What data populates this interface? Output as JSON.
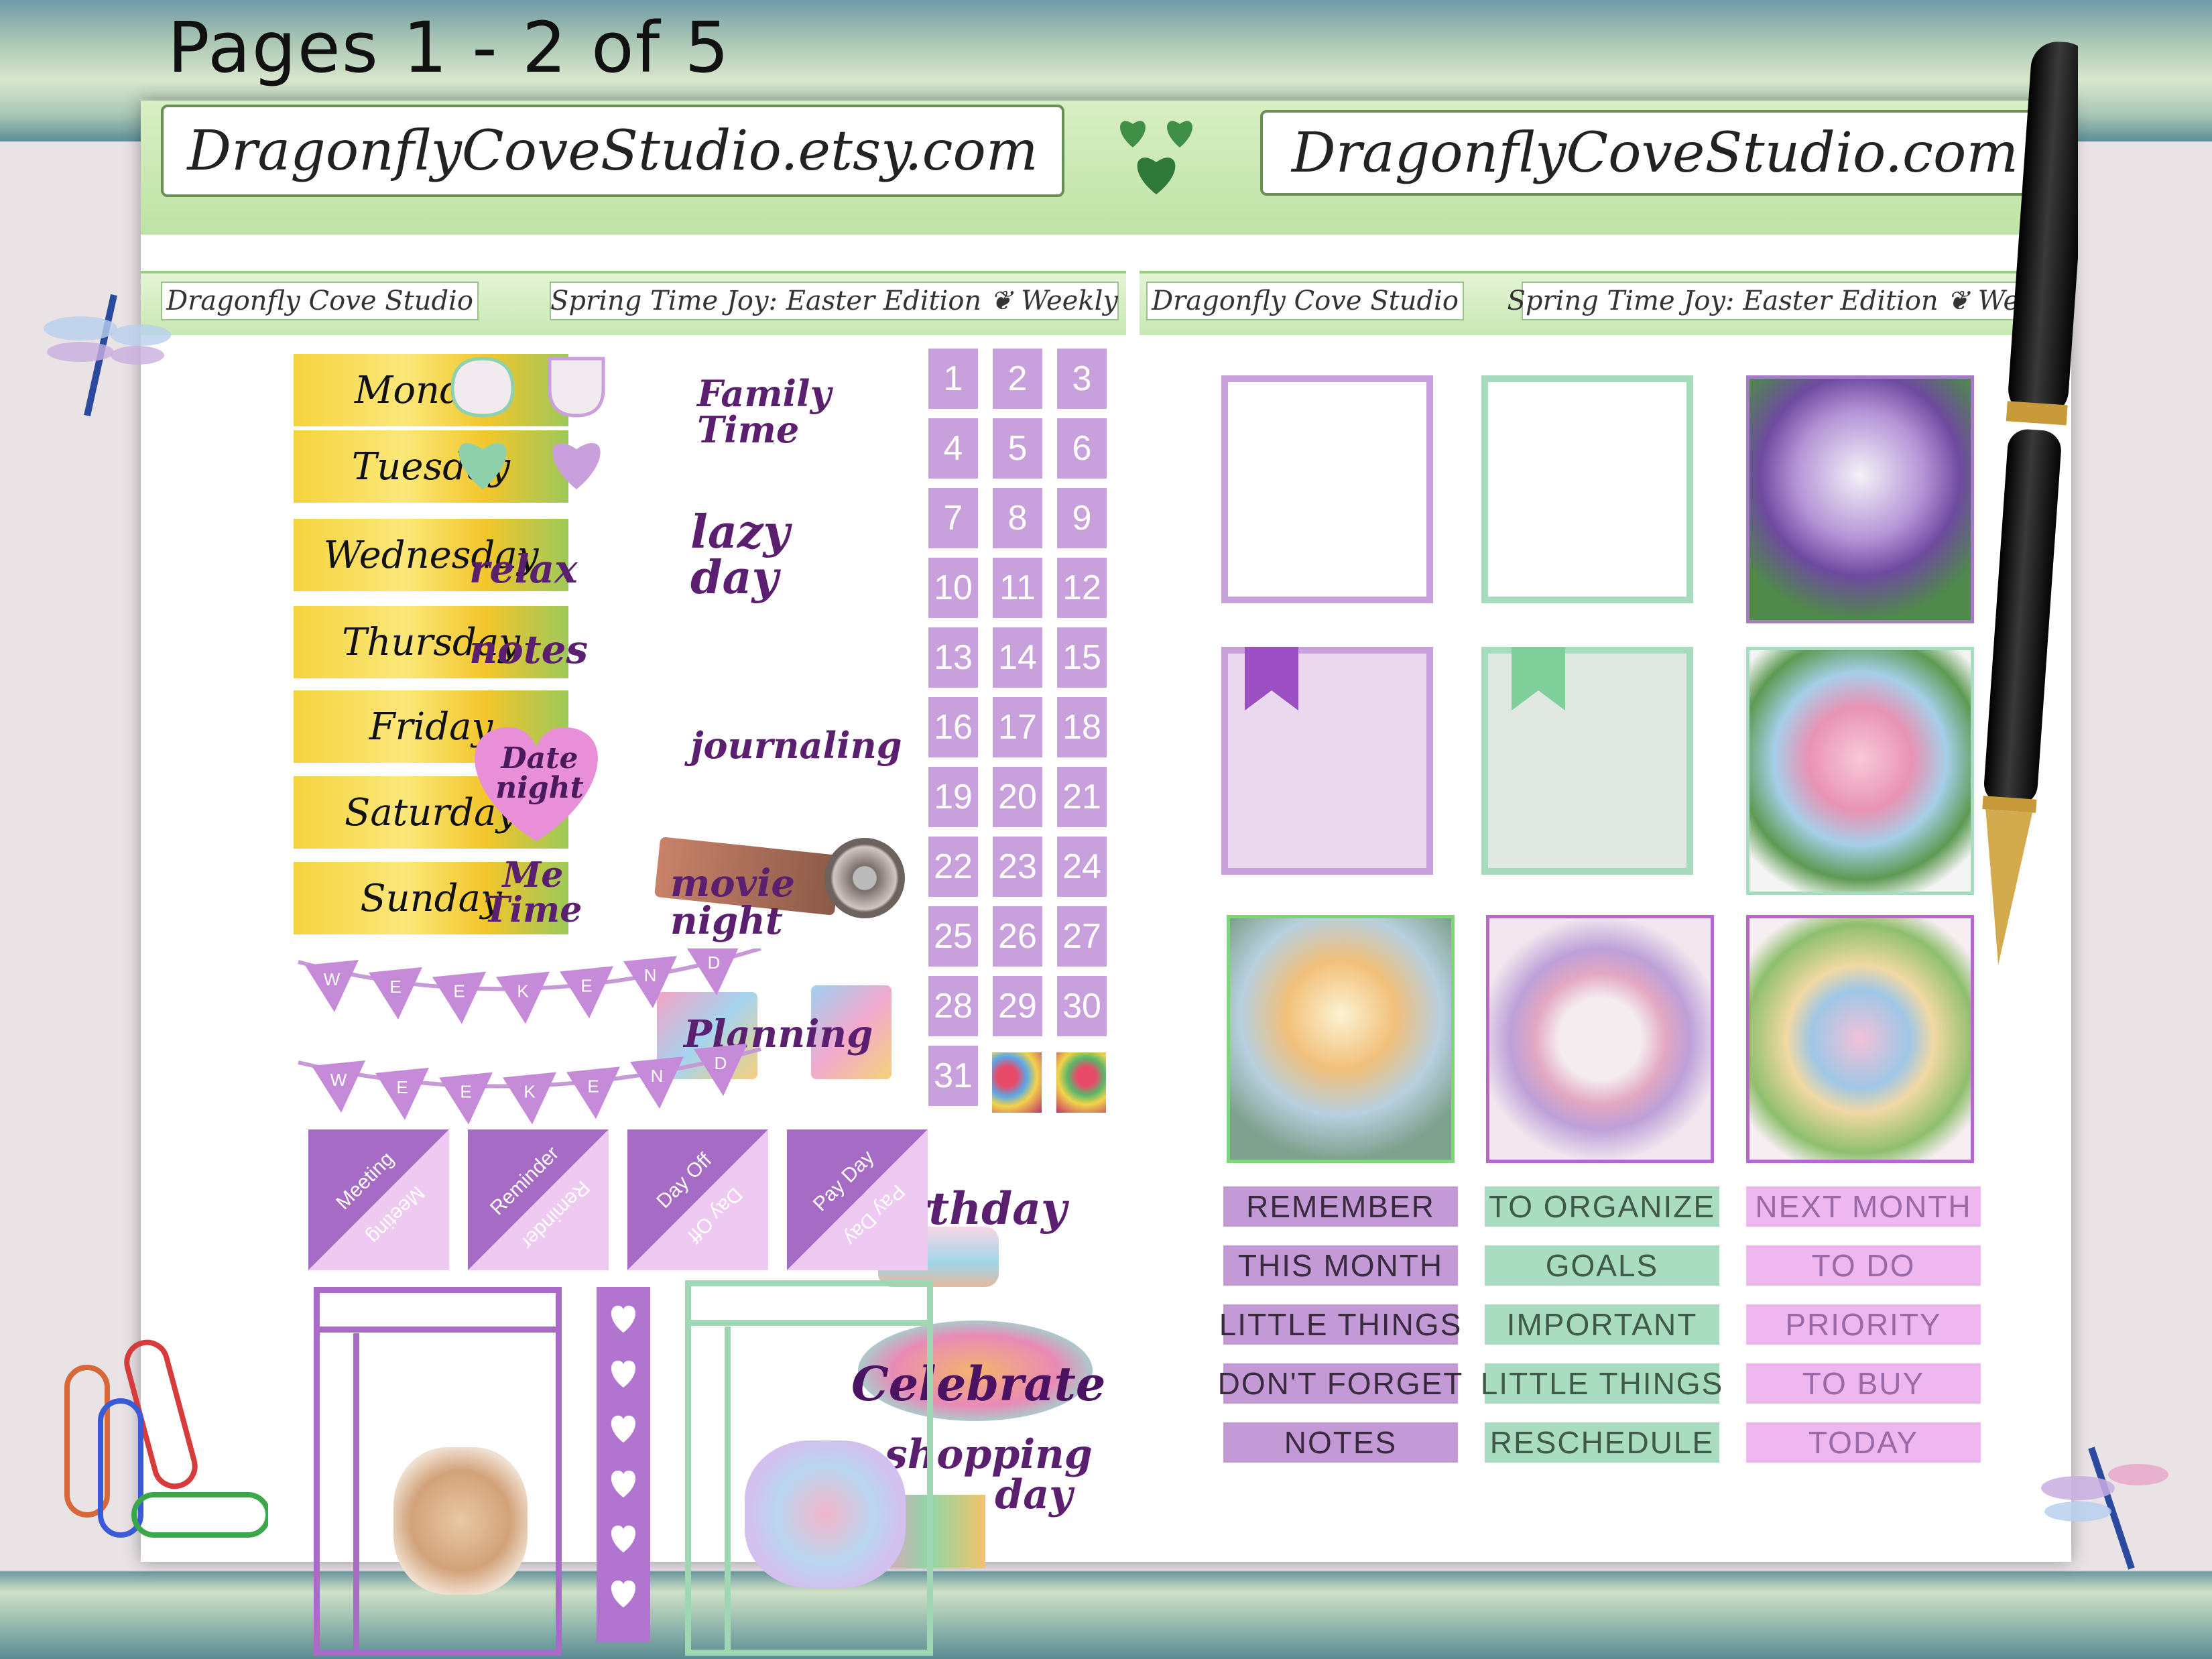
{
  "page_title": "Pages 1 - 2 of 5",
  "urls": {
    "etsy": "DragonflyCoveStudio.etsy.com",
    "site": "DragonflyCoveStudio.com"
  },
  "headers": [
    {
      "studio": "Dragonfly Cove Studio",
      "edition": "Spring Time Joy: Easter Edition ❦ Weekly"
    },
    {
      "studio": "Dragonfly Cove Studio",
      "edition": "Spring Time Joy: Easter Edition ❦ Weekly"
    }
  ],
  "days": [
    "Monday",
    "Tuesday",
    "Wednesday",
    "Thursday",
    "Friday",
    "Saturday",
    "Sunday"
  ],
  "date_numbers": [
    "1",
    "2",
    "3",
    "4",
    "5",
    "6",
    "7",
    "8",
    "9",
    "10",
    "11",
    "12",
    "13",
    "14",
    "15",
    "16",
    "17",
    "18",
    "19",
    "20",
    "21",
    "22",
    "23",
    "24",
    "25",
    "26",
    "27",
    "28",
    "29",
    "30",
    "31"
  ],
  "script_stickers": {
    "relax": "relax",
    "notes": "notes",
    "date_night": "Date night",
    "me_time": "Me Time",
    "family_time": "Family Time",
    "lazy_day": "lazy day",
    "journaling": "journaling",
    "movie_night": "movie night",
    "planning": "Planning",
    "birthday": "Birthday",
    "celebrate": "Celebrate",
    "shopping_day": "shopping day"
  },
  "banner_letters": [
    "W",
    "E",
    "E",
    "K",
    "E",
    "N",
    "D"
  ],
  "half_boxes": [
    {
      "top": "Meeting",
      "bottom": "Meeting"
    },
    {
      "top": "Reminder",
      "bottom": "Reminder"
    },
    {
      "top": "Day Off",
      "bottom": "Day Off"
    },
    {
      "top": "Pay Day",
      "bottom": "Pay Day"
    }
  ],
  "labels": {
    "purple": [
      "REMEMBER",
      "THIS MONTH",
      "LITTLE THINGS",
      "DON'T FORGET",
      "NOTES"
    ],
    "green": [
      "TO ORGANIZE",
      "GOALS",
      "IMPORTANT",
      "LITTLE THINGS",
      "RESCHEDULE"
    ],
    "pink": [
      "NEXT MONTH",
      "TO DO",
      "PRIORITY",
      "TO BUY",
      "TODAY"
    ]
  },
  "colors": {
    "purple": "#b07cc6",
    "light_purple": "#e6c9ee",
    "green": "#a6dbbd",
    "dark_text": "#5a1f6e",
    "accent_green": "#6abf80"
  }
}
